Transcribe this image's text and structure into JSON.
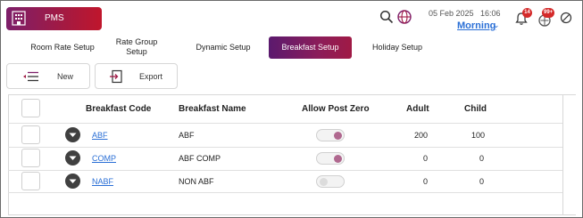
{
  "app": {
    "title": "PMS"
  },
  "header": {
    "date": "05 Feb 2025",
    "time": "16:06",
    "shift": "Morning",
    "notifications_count": "14",
    "messages_count": "99+"
  },
  "tabs": [
    {
      "label": "Room Rate Setup",
      "active": false
    },
    {
      "label": "Rate Group Setup",
      "active": false
    },
    {
      "label": "Dynamic Setup",
      "active": false
    },
    {
      "label": "Breakfast Setup",
      "active": true
    },
    {
      "label": "Holiday Setup",
      "active": false
    }
  ],
  "toolbar": {
    "new_label": "New",
    "export_label": "Export"
  },
  "table": {
    "columns": [
      "Breakfast Code",
      "Breakfast Name",
      "Allow Post Zero",
      "Adult",
      "Child"
    ],
    "rows": [
      {
        "code": "ABF",
        "name": "ABF",
        "allow_post_zero": true,
        "adult": "200",
        "child": "100"
      },
      {
        "code": "COMP",
        "name": "ABF COMP",
        "allow_post_zero": true,
        "adult": "0",
        "child": "0"
      },
      {
        "code": "NABF",
        "name": "NON ABF",
        "allow_post_zero": false,
        "adult": "0",
        "child": "0"
      }
    ]
  },
  "colors": {
    "brand_gradient_start": "#7d1f6a",
    "brand_gradient_end": "#c0162c",
    "link": "#2a6fd6",
    "toggle_on_knob": "#b0688f",
    "badge": "#d42a2a"
  }
}
